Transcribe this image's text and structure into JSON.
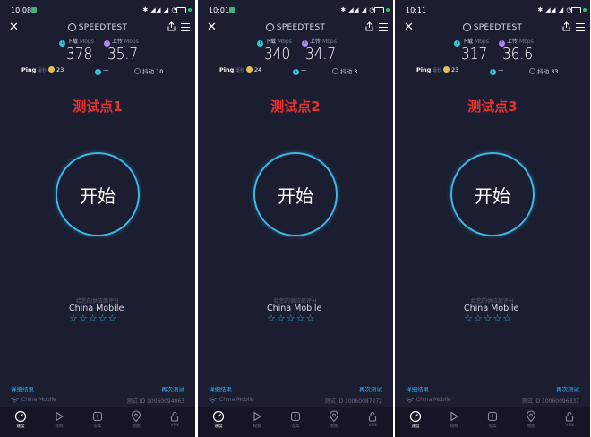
{
  "app": {
    "logo": "SPEEDTEST"
  },
  "labels": {
    "download": "下载",
    "upload": "上传",
    "unit_mbps": "Mbps",
    "ping": "Ping",
    "ping_unit": "毫秒",
    "jitter": "抖动",
    "start": "开始",
    "rate_hint": "给您的供应商评分",
    "provider": "China Mobile",
    "stars": "☆☆☆☆☆",
    "detail": "详细结果",
    "retest": "再次测试",
    "network": "China Mobile",
    "dash": "—"
  },
  "nav": [
    "速度",
    "视频",
    "答案",
    "地图",
    "VPN"
  ],
  "colors": {
    "accent": "#3fb6e4",
    "label_red": "#e8302f",
    "background": "#1b1d30"
  },
  "panels": [
    {
      "time": "10:08",
      "test_label": "测试点1",
      "download": "378",
      "upload": "35.7",
      "ping": "23",
      "jitter": "10",
      "test_id": "测试 ID 10060094063"
    },
    {
      "time": "10:01",
      "test_label": "测试点2",
      "download": "340",
      "upload": "34.7",
      "ping": "24",
      "jitter": "3",
      "test_id": "测试 ID 10060087272"
    },
    {
      "time": "10:11",
      "test_label": "测试点3",
      "download": "317",
      "upload": "36.6",
      "ping": "23",
      "jitter": "33",
      "test_id": "测试 ID 10060096837"
    }
  ]
}
